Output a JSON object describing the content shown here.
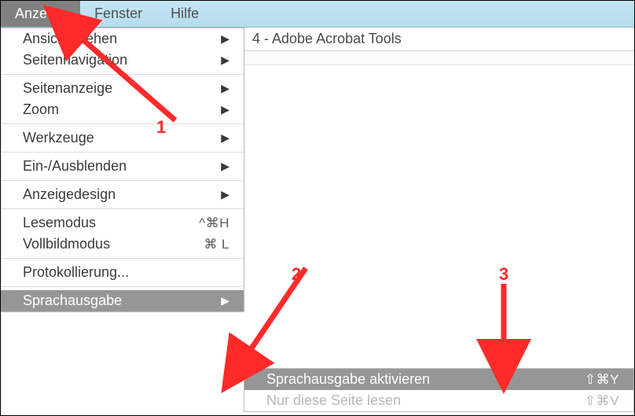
{
  "menubar": {
    "items": [
      {
        "label": "Anzeige",
        "active": true
      },
      {
        "label": "Fenster",
        "active": false
      },
      {
        "label": "Hilfe",
        "active": false
      }
    ]
  },
  "title_strip": {
    "text": "4 - Adobe Acrobat Tools"
  },
  "menu": {
    "groups": [
      [
        {
          "label": "Ansicht drehen",
          "submenu": true
        },
        {
          "label": "Seitennavigation",
          "submenu": true
        }
      ],
      [
        {
          "label": "Seitenanzeige",
          "submenu": true
        },
        {
          "label": "Zoom",
          "submenu": true
        }
      ],
      [
        {
          "label": "Werkzeuge",
          "submenu": true
        }
      ],
      [
        {
          "label": "Ein-/Ausblenden",
          "submenu": true
        }
      ],
      [
        {
          "label": "Anzeigedesign",
          "submenu": true
        }
      ],
      [
        {
          "label": "Lesemodus",
          "shortcut": "^⌘H"
        },
        {
          "label": "Vollbildmodus",
          "shortcut": "⌘ L"
        }
      ],
      [
        {
          "label": "Protokollierung..."
        }
      ],
      [
        {
          "label": "Sprachausgabe",
          "submenu": true,
          "highlight": true
        }
      ]
    ]
  },
  "submenu": {
    "rows": [
      {
        "label": "Sprachausgabe aktivieren",
        "shortcut": "⇧⌘Y",
        "highlight": true
      },
      {
        "label": "Nur diese Seite lesen",
        "shortcut": "⇧⌘V",
        "disabled": true
      }
    ]
  },
  "annotations": {
    "one": "1",
    "two": "2",
    "three": "3"
  },
  "icons": {
    "submenu_arrow": "▶"
  }
}
